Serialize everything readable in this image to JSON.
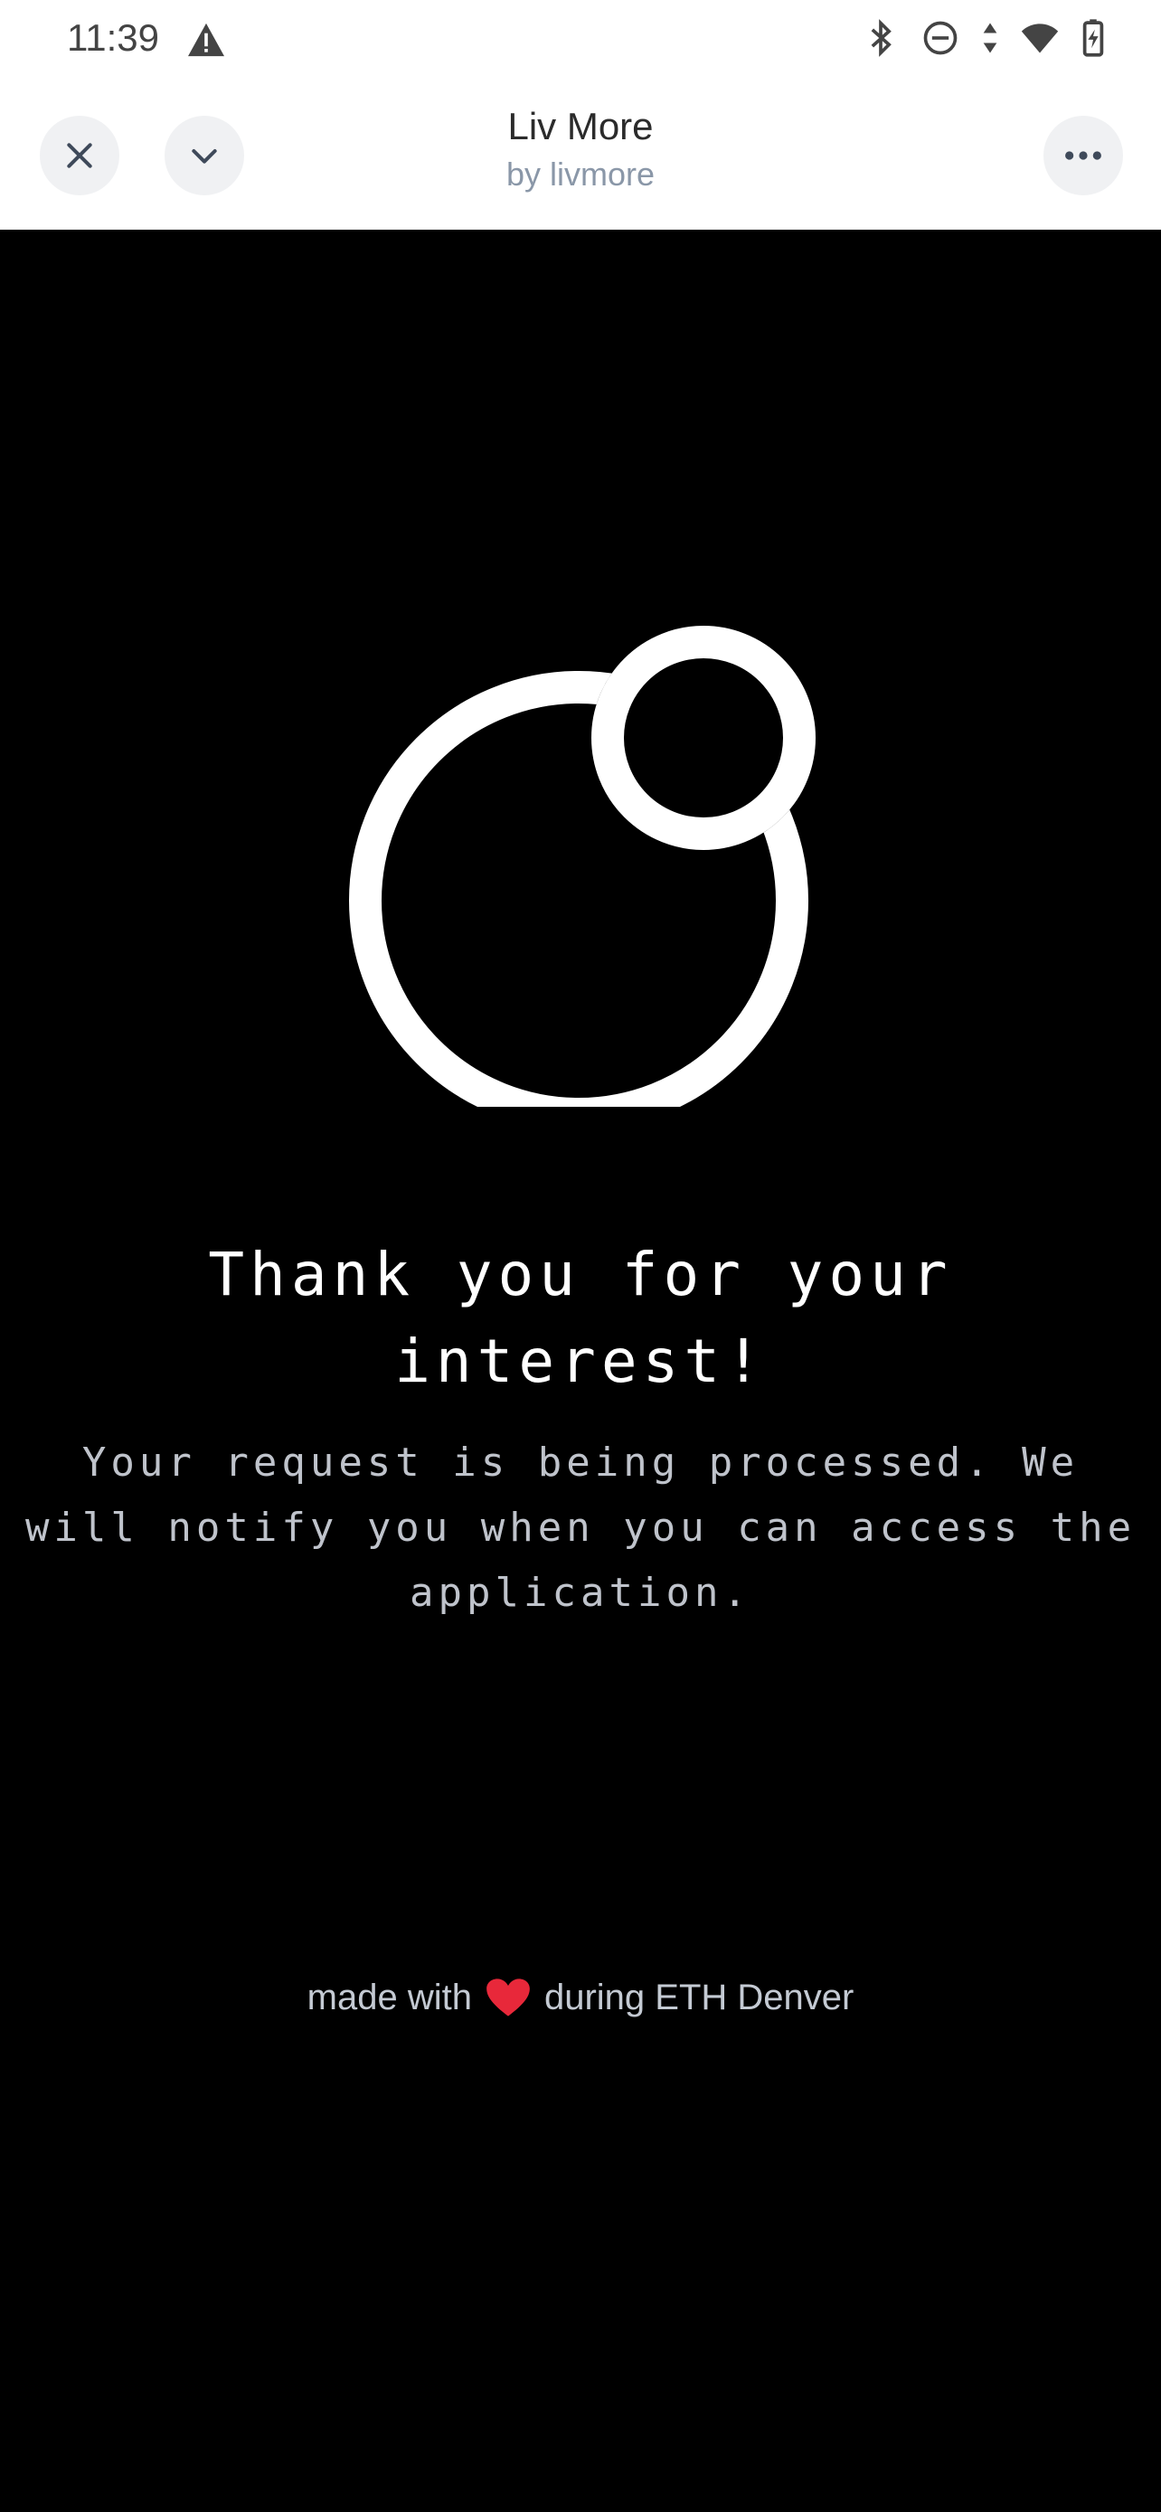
{
  "status_bar": {
    "time": "11:39",
    "icons": [
      "warning-icon",
      "bluetooth-icon",
      "do-not-disturb-icon",
      "data-arrows-icon",
      "wifi-icon",
      "battery-charging-icon"
    ]
  },
  "browser_bar": {
    "title": "Liv More",
    "subtitle": "by livmore",
    "buttons": [
      "close-icon",
      "chevron-down-icon",
      "more-horizontal-icon"
    ]
  },
  "main": {
    "headline_line1": "Thank you for your",
    "headline_line2": "interest!",
    "message_line1": "Your request is being processed. We",
    "message_line2": "will notify you when you can access the",
    "message_line3": "application."
  },
  "footer": {
    "before": "made with",
    "after": "during ETH Denver",
    "heart_color": "#e8283a"
  }
}
